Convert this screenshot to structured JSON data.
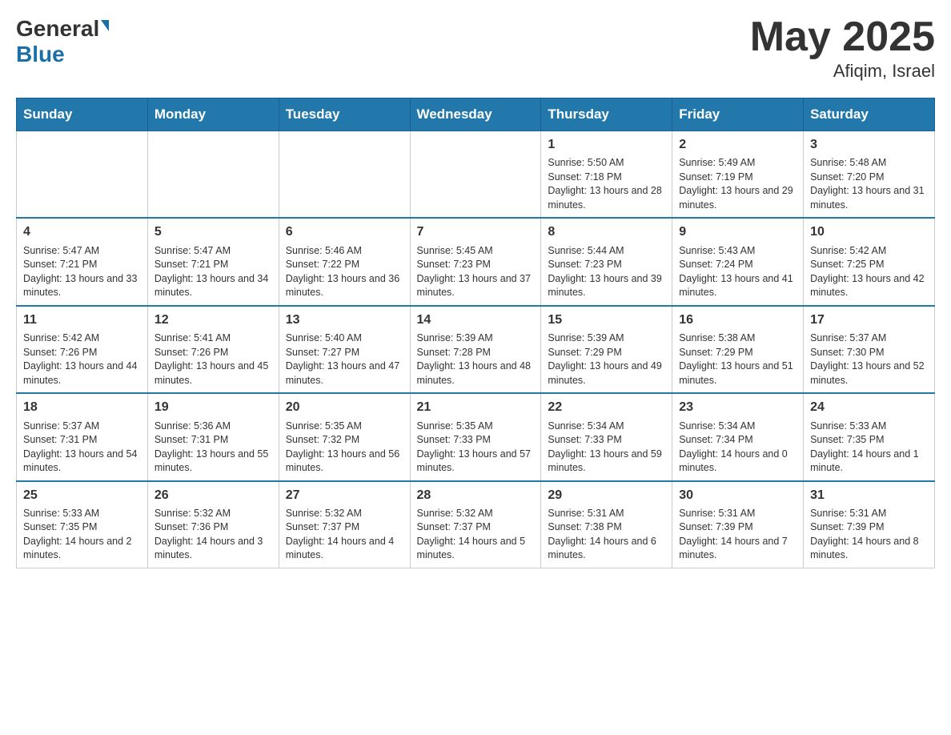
{
  "header": {
    "logo_general": "General",
    "logo_blue": "Blue",
    "month_year": "May 2025",
    "location": "Afiqim, Israel"
  },
  "days_of_week": [
    "Sunday",
    "Monday",
    "Tuesday",
    "Wednesday",
    "Thursday",
    "Friday",
    "Saturday"
  ],
  "weeks": [
    [
      {
        "day": "",
        "info": ""
      },
      {
        "day": "",
        "info": ""
      },
      {
        "day": "",
        "info": ""
      },
      {
        "day": "",
        "info": ""
      },
      {
        "day": "1",
        "info": "Sunrise: 5:50 AM\nSunset: 7:18 PM\nDaylight: 13 hours and 28 minutes."
      },
      {
        "day": "2",
        "info": "Sunrise: 5:49 AM\nSunset: 7:19 PM\nDaylight: 13 hours and 29 minutes."
      },
      {
        "day": "3",
        "info": "Sunrise: 5:48 AM\nSunset: 7:20 PM\nDaylight: 13 hours and 31 minutes."
      }
    ],
    [
      {
        "day": "4",
        "info": "Sunrise: 5:47 AM\nSunset: 7:21 PM\nDaylight: 13 hours and 33 minutes."
      },
      {
        "day": "5",
        "info": "Sunrise: 5:47 AM\nSunset: 7:21 PM\nDaylight: 13 hours and 34 minutes."
      },
      {
        "day": "6",
        "info": "Sunrise: 5:46 AM\nSunset: 7:22 PM\nDaylight: 13 hours and 36 minutes."
      },
      {
        "day": "7",
        "info": "Sunrise: 5:45 AM\nSunset: 7:23 PM\nDaylight: 13 hours and 37 minutes."
      },
      {
        "day": "8",
        "info": "Sunrise: 5:44 AM\nSunset: 7:23 PM\nDaylight: 13 hours and 39 minutes."
      },
      {
        "day": "9",
        "info": "Sunrise: 5:43 AM\nSunset: 7:24 PM\nDaylight: 13 hours and 41 minutes."
      },
      {
        "day": "10",
        "info": "Sunrise: 5:42 AM\nSunset: 7:25 PM\nDaylight: 13 hours and 42 minutes."
      }
    ],
    [
      {
        "day": "11",
        "info": "Sunrise: 5:42 AM\nSunset: 7:26 PM\nDaylight: 13 hours and 44 minutes."
      },
      {
        "day": "12",
        "info": "Sunrise: 5:41 AM\nSunset: 7:26 PM\nDaylight: 13 hours and 45 minutes."
      },
      {
        "day": "13",
        "info": "Sunrise: 5:40 AM\nSunset: 7:27 PM\nDaylight: 13 hours and 47 minutes."
      },
      {
        "day": "14",
        "info": "Sunrise: 5:39 AM\nSunset: 7:28 PM\nDaylight: 13 hours and 48 minutes."
      },
      {
        "day": "15",
        "info": "Sunrise: 5:39 AM\nSunset: 7:29 PM\nDaylight: 13 hours and 49 minutes."
      },
      {
        "day": "16",
        "info": "Sunrise: 5:38 AM\nSunset: 7:29 PM\nDaylight: 13 hours and 51 minutes."
      },
      {
        "day": "17",
        "info": "Sunrise: 5:37 AM\nSunset: 7:30 PM\nDaylight: 13 hours and 52 minutes."
      }
    ],
    [
      {
        "day": "18",
        "info": "Sunrise: 5:37 AM\nSunset: 7:31 PM\nDaylight: 13 hours and 54 minutes."
      },
      {
        "day": "19",
        "info": "Sunrise: 5:36 AM\nSunset: 7:31 PM\nDaylight: 13 hours and 55 minutes."
      },
      {
        "day": "20",
        "info": "Sunrise: 5:35 AM\nSunset: 7:32 PM\nDaylight: 13 hours and 56 minutes."
      },
      {
        "day": "21",
        "info": "Sunrise: 5:35 AM\nSunset: 7:33 PM\nDaylight: 13 hours and 57 minutes."
      },
      {
        "day": "22",
        "info": "Sunrise: 5:34 AM\nSunset: 7:33 PM\nDaylight: 13 hours and 59 minutes."
      },
      {
        "day": "23",
        "info": "Sunrise: 5:34 AM\nSunset: 7:34 PM\nDaylight: 14 hours and 0 minutes."
      },
      {
        "day": "24",
        "info": "Sunrise: 5:33 AM\nSunset: 7:35 PM\nDaylight: 14 hours and 1 minute."
      }
    ],
    [
      {
        "day": "25",
        "info": "Sunrise: 5:33 AM\nSunset: 7:35 PM\nDaylight: 14 hours and 2 minutes."
      },
      {
        "day": "26",
        "info": "Sunrise: 5:32 AM\nSunset: 7:36 PM\nDaylight: 14 hours and 3 minutes."
      },
      {
        "day": "27",
        "info": "Sunrise: 5:32 AM\nSunset: 7:37 PM\nDaylight: 14 hours and 4 minutes."
      },
      {
        "day": "28",
        "info": "Sunrise: 5:32 AM\nSunset: 7:37 PM\nDaylight: 14 hours and 5 minutes."
      },
      {
        "day": "29",
        "info": "Sunrise: 5:31 AM\nSunset: 7:38 PM\nDaylight: 14 hours and 6 minutes."
      },
      {
        "day": "30",
        "info": "Sunrise: 5:31 AM\nSunset: 7:39 PM\nDaylight: 14 hours and 7 minutes."
      },
      {
        "day": "31",
        "info": "Sunrise: 5:31 AM\nSunset: 7:39 PM\nDaylight: 14 hours and 8 minutes."
      }
    ]
  ]
}
